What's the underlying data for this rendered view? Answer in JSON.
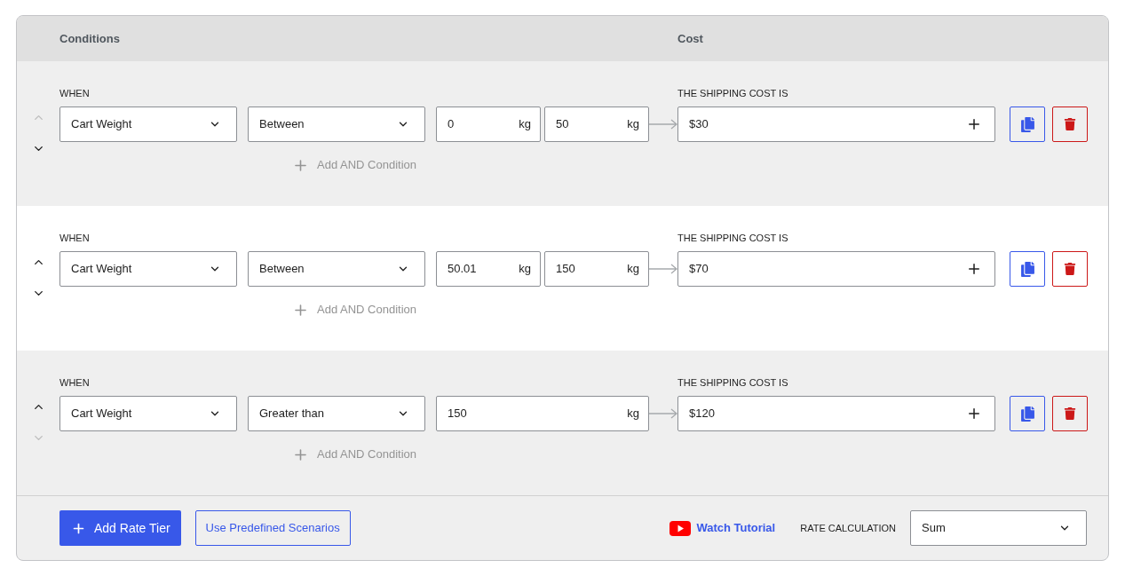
{
  "header": {
    "conditions": "Conditions",
    "cost": "Cost"
  },
  "tiers": [
    {
      "when_label": "WHEN",
      "move_up": {
        "disabled": true
      },
      "move_down": {
        "disabled": false
      },
      "field": "Cart Weight",
      "operator": "Between",
      "inputs": [
        {
          "value": "0",
          "unit": "kg"
        },
        {
          "value": "50",
          "unit": "kg"
        }
      ],
      "add_condition": "Add AND Condition",
      "cost_label": "THE SHIPPING COST IS",
      "cost": "$30"
    },
    {
      "when_label": "WHEN",
      "move_up": {
        "disabled": false
      },
      "move_down": {
        "disabled": false
      },
      "field": "Cart Weight",
      "operator": "Between",
      "inputs": [
        {
          "value": "50.01",
          "unit": "kg"
        },
        {
          "value": "150",
          "unit": "kg"
        }
      ],
      "add_condition": "Add AND Condition",
      "cost_label": "THE SHIPPING COST IS",
      "cost": "$70"
    },
    {
      "when_label": "WHEN",
      "move_up": {
        "disabled": false
      },
      "move_down": {
        "disabled": true
      },
      "field": "Cart Weight",
      "operator": "Greater than",
      "inputs": [
        {
          "value": "150",
          "unit": "kg"
        }
      ],
      "add_condition": "Add AND Condition",
      "cost_label": "THE SHIPPING COST IS",
      "cost": "$120"
    }
  ],
  "footer": {
    "add_tier": "Add Rate Tier",
    "scenarios": "Use Predefined Scenarios",
    "tutorial": "Watch Tutorial",
    "rate_calculation": {
      "label": "RATE CALCULATION",
      "value": "Sum"
    }
  }
}
